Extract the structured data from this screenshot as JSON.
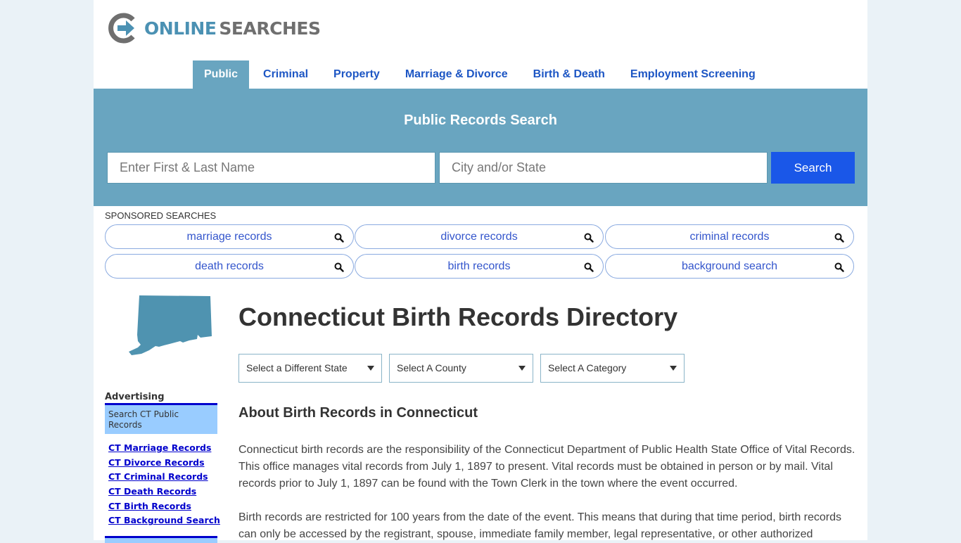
{
  "brand": {
    "logo_part1": "ONLINE",
    "logo_part2": "SEARCHES",
    "colors": {
      "accent": "#69a5c0",
      "link": "#1d56c4",
      "button": "#1a57e8",
      "logo_blue": "#4b91b3",
      "logo_gray": "#6f6f6f"
    }
  },
  "nav": {
    "items": [
      {
        "label": "Public",
        "active": true
      },
      {
        "label": "Criminal"
      },
      {
        "label": "Property"
      },
      {
        "label": "Marriage & Divorce"
      },
      {
        "label": "Birth & Death"
      },
      {
        "label": "Employment Screening"
      }
    ]
  },
  "search": {
    "title": "Public Records Search",
    "name_placeholder": "Enter First & Last Name",
    "name_value": "",
    "city_placeholder": "City and/or State",
    "city_value": "",
    "button_label": "Search"
  },
  "sponsored": {
    "label": "SPONSORED SEARCHES",
    "items": [
      {
        "label": "marriage records",
        "icon": "search-icon"
      },
      {
        "label": "divorce records",
        "icon": "search-icon"
      },
      {
        "label": "criminal records",
        "icon": "search-icon"
      },
      {
        "label": "death records",
        "icon": "search-icon"
      },
      {
        "label": "birth records",
        "icon": "search-icon"
      },
      {
        "label": "background search",
        "icon": "search-icon"
      }
    ]
  },
  "sidebar": {
    "map_icon": "connecticut-map-icon",
    "advertising_title": "Advertising",
    "ad_box_text": "Search CT Public Records",
    "links": [
      "CT Marriage Records",
      "CT Divorce Records",
      "CT Criminal Records",
      "CT Death Records",
      "CT Birth Records",
      "CT Background Search"
    ]
  },
  "main": {
    "title": "Connecticut Birth Records Directory",
    "selects": [
      {
        "value": "Select a Different State"
      },
      {
        "value": "Select A County"
      },
      {
        "value": "Select A Category"
      }
    ],
    "section_title": "About Birth Records in Connecticut",
    "paragraphs": [
      "Connecticut birth records are the responsibility of the Connecticut Department of Public Health State Office of Vital Records. This office manages vital records from July 1, 1897 to present. Vital records must be obtained in person or by mail. Vital records prior to July 1, 1897 can be found with the Town Clerk in the town where the event occurred.",
      "Birth records are restricted for 100 years from the date of the event. This means that during that time period, birth records can only be accessed by the registrant, spouse, immediate family member, legal representative, or other authorized"
    ]
  }
}
